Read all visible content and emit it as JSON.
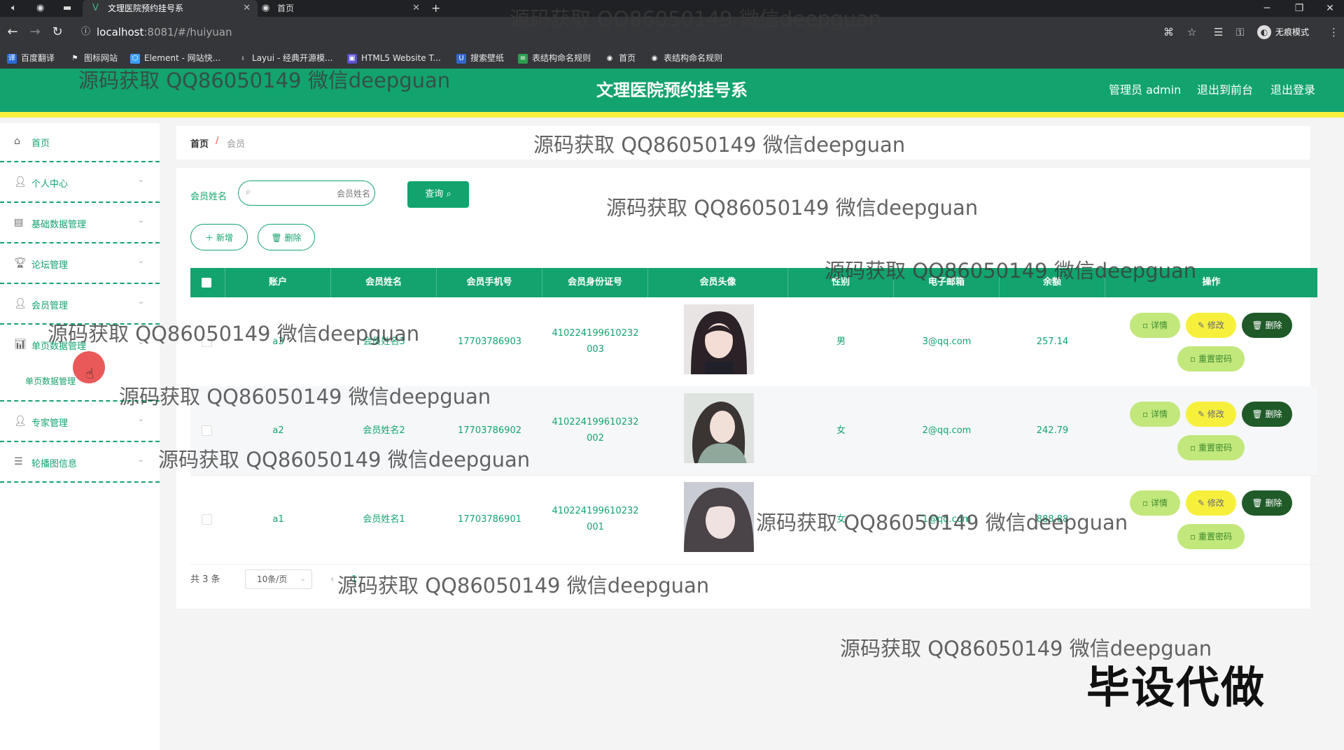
{
  "browser": {
    "tabs": [
      {
        "title": "文理医院预约挂号系",
        "active": true,
        "icon": "vue-logo-icon"
      },
      {
        "title": "首页",
        "active": false,
        "icon": "globe-icon"
      }
    ],
    "url_host": "localhost",
    "url_path": ":8081/#/huiyuan",
    "profile_label": "无痕模式",
    "bookmarks": [
      "百度翻译",
      "图标网站",
      "Element - 网站快...",
      "Layui - 经典开源模...",
      "HTML5 Website T...",
      "搜索壁纸",
      "表结构命名规则",
      "首页",
      "表结构命名规则"
    ]
  },
  "header": {
    "title": "文理医院预约挂号系",
    "admin_label": "管理员 admin",
    "to_front": "退出到前台",
    "logout": "退出登录"
  },
  "sidebar": {
    "items": [
      {
        "label": "首页",
        "icon": "home-icon"
      },
      {
        "label": "个人中心",
        "icon": "user-icon"
      },
      {
        "label": "基础数据管理",
        "icon": "clipboard-icon"
      },
      {
        "label": "论坛管理",
        "icon": "trophy-icon"
      },
      {
        "label": "会员管理",
        "icon": "user-icon"
      },
      {
        "label": "单页数据管理",
        "icon": "chart-icon"
      },
      {
        "label": "专家管理",
        "icon": "user-icon"
      },
      {
        "label": "轮播图信息",
        "icon": "list-icon"
      }
    ],
    "sub_item": "单页数据管理"
  },
  "breadcrumb": {
    "home": "首页",
    "sep": "/",
    "current": "会员"
  },
  "search": {
    "label": "会员姓名",
    "placeholder": "会员姓名",
    "query_button": "查询"
  },
  "actions": {
    "add": "新增",
    "delete": "删除"
  },
  "table": {
    "columns": [
      "账户",
      "会员姓名",
      "会员手机号",
      "会员身份证号",
      "会员头像",
      "性别",
      "电子邮箱",
      "余额",
      "操作"
    ],
    "rows": [
      {
        "account": "a3",
        "name": "会员姓名3",
        "phone": "17703786903",
        "id1": "410224199610232",
        "id2": "003",
        "gender": "男",
        "email": "3@qq.com",
        "balance": "257.14"
      },
      {
        "account": "a2",
        "name": "会员姓名2",
        "phone": "17703786902",
        "id1": "410224199610232",
        "id2": "002",
        "gender": "女",
        "email": "2@qq.com",
        "balance": "242.79"
      },
      {
        "account": "a1",
        "name": "会员姓名1",
        "phone": "17703786901",
        "id1": "410224199610232",
        "id2": "001",
        "gender": "女",
        "email": "1@qq.com",
        "balance": "888.88"
      }
    ],
    "ops": {
      "detail": "详情",
      "edit": "修改",
      "delete": "删除",
      "reset": "重置密码"
    }
  },
  "pager": {
    "total": "共 3 条",
    "page_size": "10条/页",
    "page": "1"
  },
  "watermark": "源码获取 QQ86050149 微信deepguan",
  "big_watermark": "毕设代做",
  "colors": {
    "primary": "#13a36e",
    "accent_bar": "#f7f03f",
    "detail_btn": "#c2e77b",
    "edit_btn": "#f6f03c",
    "delete_btn": "#1f5a28"
  }
}
